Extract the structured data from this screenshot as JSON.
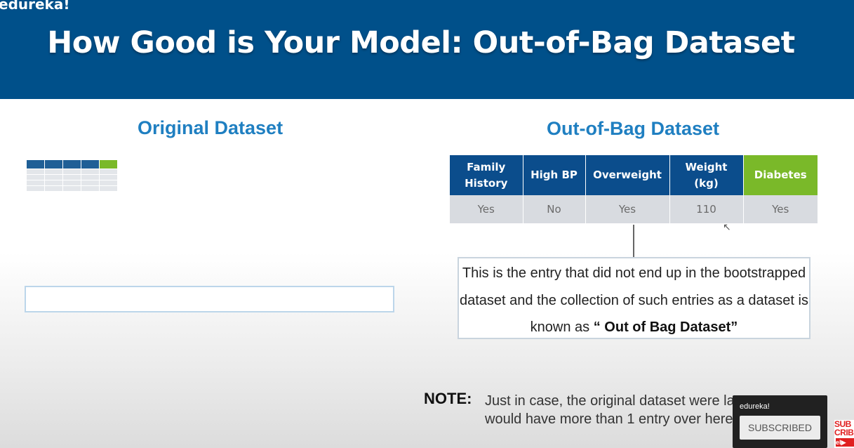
{
  "header": {
    "brand": "edureka!",
    "title": "How Good is Your Model: Out-of-Bag Dataset"
  },
  "left": {
    "heading": "Original Dataset"
  },
  "right": {
    "heading": "Out-of-Bag Dataset",
    "table": {
      "columns": [
        "Family History",
        "High BP",
        "Overweight",
        "Weight (kg)",
        "Diabetes"
      ],
      "row": [
        "Yes",
        "No",
        "Yes",
        "110",
        "Yes"
      ]
    },
    "explanation": {
      "before": "This is the entry that did not end up in the bootstrapped dataset and the collection of such entries as a dataset is known as ",
      "bold": "“ Out of Bag Dataset”"
    }
  },
  "note": {
    "label": "NOTE:",
    "text": "Just in case, the original dataset were larger, we would have more than 1 entry over here."
  },
  "subscribe_card": {
    "channel": "edureka!",
    "button_label": "SUBSCRIBED"
  },
  "colors": {
    "header_bg": "#00508a",
    "heading_blue": "#1f7fc1",
    "table_header": "#0b4d8c",
    "diabetes_green": "#7ab929"
  }
}
